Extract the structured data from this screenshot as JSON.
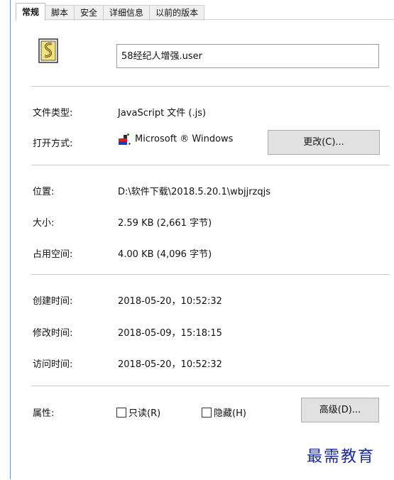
{
  "tabs": [
    {
      "label": "常规",
      "active": true
    },
    {
      "label": "脚本",
      "active": false
    },
    {
      "label": "安全",
      "active": false
    },
    {
      "label": "详细信息",
      "active": false
    },
    {
      "label": "以前的版本",
      "active": false
    }
  ],
  "file": {
    "icon": "script-file-icon",
    "name": "58经纪人增强.user"
  },
  "fields": {
    "type_label": "文件类型:",
    "type_value": "JavaScript 文件 (.js)",
    "open_with_label": "打开方式:",
    "open_with_value": "Microsoft ® Windows",
    "change_button": "更改(C)...",
    "location_label": "位置:",
    "location_value": "D:\\软件下载\\2018.5.20.1\\wbjjrzqjs",
    "size_label": "大小:",
    "size_value": "2.59 KB (2,661 字节)",
    "size_on_disk_label": "占用空间:",
    "size_on_disk_value": "4.00 KB (4,096 字节)",
    "created_label": "创建时间:",
    "created_value": "2018-05-20，10:52:32",
    "modified_label": "修改时间:",
    "modified_value": "2018-05-09，15:18:15",
    "accessed_label": "访问时间:",
    "accessed_value": "2018-05-20，10:52:32"
  },
  "attributes": {
    "label": "属性:",
    "readonly_label": "只读(R)",
    "readonly_checked": false,
    "hidden_label": "隐藏(H)",
    "hidden_checked": false,
    "advanced_button": "高级(D)..."
  },
  "watermark": "最需教育"
}
